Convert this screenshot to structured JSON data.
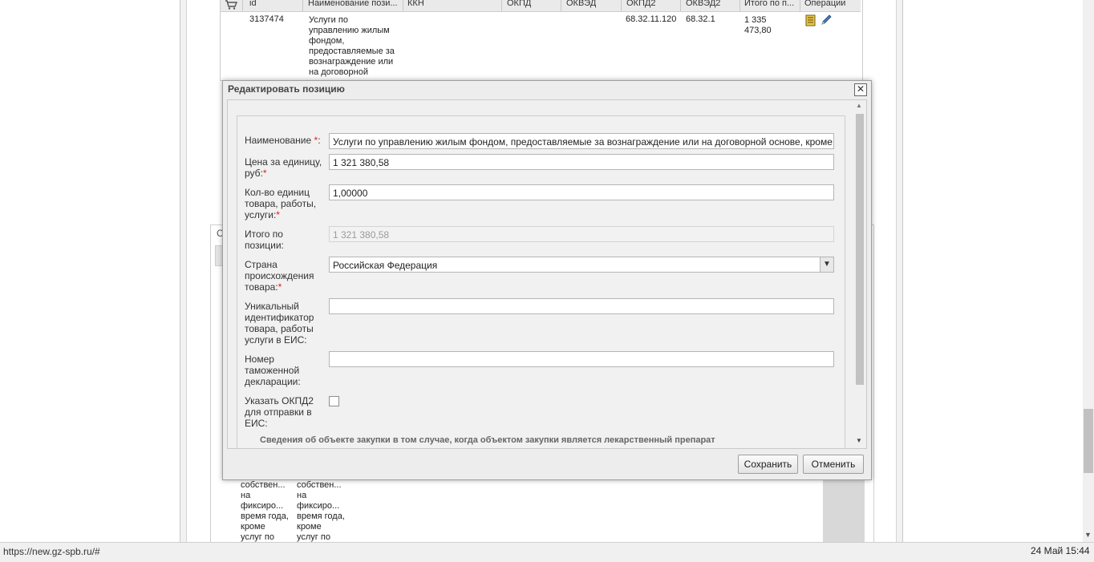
{
  "table": {
    "headers": [
      "id",
      "Наименование пози...",
      "ККН",
      "ОКПД",
      "ОКВЭД",
      "ОКПД2",
      "ОКВЭД2",
      "Итого по п...",
      "Операции"
    ],
    "row": {
      "id": "3137474",
      "name_lines": [
        "Услуги по",
        "управлению жилым",
        "фондом,",
        "предоставляемые за",
        "вознаграждение или",
        "на договорной"
      ],
      "okpd2": "68.32.11.120",
      "okved2": "68.32.1",
      "total_lines": [
        "1 335",
        "473,80"
      ]
    }
  },
  "bottom_grid": {
    "col1_lines": [
      "собствен...",
      "на",
      "фиксиро...",
      "время года,",
      "кроме",
      "услуг по"
    ],
    "col2_lines": [
      "собствен...",
      "на",
      "фиксиро...",
      "время года,",
      "кроме",
      "услуг по"
    ]
  },
  "side": {
    "letter": "С"
  },
  "dialog": {
    "title": "Редактировать позицию",
    "close_glyph": "✕",
    "fields": {
      "name": {
        "label": "Наименование ",
        "required": "*",
        "suffix": ":",
        "value": "Услуги по управлению жилым фондом, предоставляемые за вознаграждение или на договорной основе, кроме"
      },
      "price": {
        "label_lines": [
          "Цена за единицу,",
          "руб:"
        ],
        "required": "*",
        "value": "1 321 380,58"
      },
      "qty": {
        "label_lines": [
          "Кол-во единиц",
          "товара, работы,",
          "услуги:"
        ],
        "required": "*",
        "value": "1,00000"
      },
      "total": {
        "label_lines": [
          "Итого по",
          "позиции:"
        ],
        "value": "1 321 380,58"
      },
      "country": {
        "label_lines": [
          "Страна",
          "происхождения",
          "товара:"
        ],
        "required": "*",
        "value": "Российская Федерация"
      },
      "uid": {
        "label_lines": [
          "Уникальный",
          "идентификатор",
          "товара, работы",
          "услуги в ЕИС:"
        ],
        "value": ""
      },
      "customs": {
        "label_lines": [
          "Номер",
          "таможенной",
          "декларации:"
        ],
        "value": ""
      },
      "okpd_flag": {
        "label_lines": [
          "Указать ОКПД2",
          "для отправки в",
          "ЕИС:"
        ],
        "checked": false
      }
    },
    "section_title": "Сведения об объекте закупки в том случае, когда объектом закупки является лекарственный препарат",
    "buttons": {
      "save": "Сохранить",
      "cancel": "Отменить"
    }
  },
  "status": {
    "url": "https://new.gz-spb.ru/#",
    "datetime": "24 Май 15:44"
  },
  "icons": {
    "cart": "cart-icon",
    "document": "document-icon",
    "edit": "pencil-icon",
    "dropdown": "chevron-down-icon"
  },
  "colors": {
    "required": "#e02020",
    "dialog_bg": "#ededed",
    "border": "#9f9f9f"
  }
}
